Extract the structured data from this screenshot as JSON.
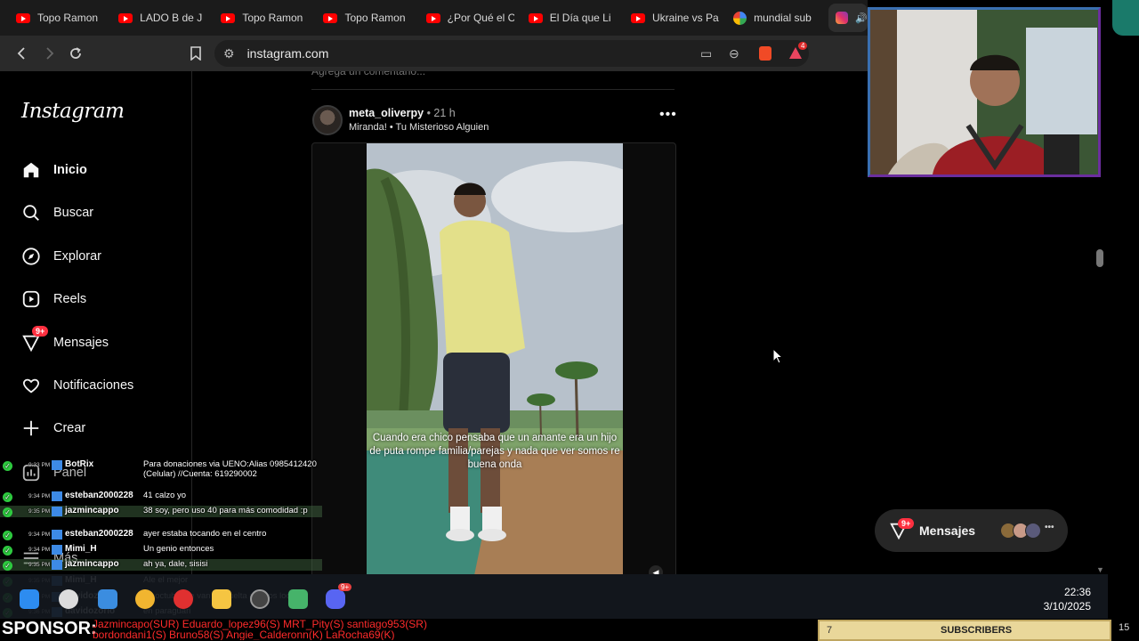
{
  "browser": {
    "tabs": [
      {
        "title": "Topo Ramon",
        "icon": "youtube-icon"
      },
      {
        "title": "LADO B de J",
        "icon": "youtube-icon"
      },
      {
        "title": "Topo Ramon",
        "icon": "youtube-icon"
      },
      {
        "title": "Topo Ramon",
        "icon": "youtube-icon"
      },
      {
        "title": "¿Por Qué el C",
        "icon": "youtube-icon"
      },
      {
        "title": "El Día que Li",
        "icon": "youtube-icon"
      },
      {
        "title": "Ukraine vs Pa",
        "icon": "youtube-icon"
      },
      {
        "title": "mundial sub",
        "icon": "google-icon"
      }
    ],
    "url": "instagram.com",
    "brave_badge": "4"
  },
  "instagram": {
    "logo": "Instagram",
    "nav": [
      {
        "label": "Inicio",
        "icon": "home-icon"
      },
      {
        "label": "Buscar",
        "icon": "search-icon"
      },
      {
        "label": "Explorar",
        "icon": "compass-icon"
      },
      {
        "label": "Reels",
        "icon": "reels-icon"
      },
      {
        "label": "Mensajes",
        "icon": "messenger-icon",
        "badge": "9+"
      },
      {
        "label": "Notificaciones",
        "icon": "heart-icon"
      },
      {
        "label": "Crear",
        "icon": "plus-icon"
      },
      {
        "label": "Panel",
        "icon": "dashboard-icon"
      },
      {
        "label": "Más",
        "icon": "menu-icon"
      }
    ],
    "comment_placeholder": "Agrega un comentario...",
    "post": {
      "username": "meta_oliverpy",
      "time": "• 21 h",
      "subtitle": "Miranda! • Tu Misterioso Alguien",
      "caption": "Cuando era chico pensaba que un amante era un hijo de puta rompe familia/parejas y nada que ver somos re buena onda"
    },
    "messages_pill": {
      "label": "Mensajes",
      "badge": "9+"
    }
  },
  "chat": [
    {
      "time": "9:33 PM",
      "user": "BotRix",
      "msg": "Para donaciones via UENO:Alias 0985412420 (Celular) //Cuenta: 619290002",
      "highlight": false
    },
    {
      "time": "9:34 PM",
      "user": "esteban2000228",
      "msg": "41 calzo yo",
      "highlight": false
    },
    {
      "time": "9:35 PM",
      "user": "jazmincappo",
      "msg": "38 soy, pero uso 40 para más comodidad :p",
      "highlight": true
    },
    {
      "time": "9:34 PM",
      "user": "esteban2000228",
      "msg": "ayer estaba tocando en el centro",
      "highlight": false
    },
    {
      "time": "9:34 PM",
      "user": "Mimi_H",
      "msg": "Un genio entonces",
      "highlight": false
    },
    {
      "time": "9:35 PM",
      "user": "jazmincappo",
      "msg": "ah ya, dale, sisisi",
      "highlight": true
    },
    {
      "time": "9:35 PM",
      "user": "Mimi_H",
      "msg": "Ale el mejor",
      "highlight": false
    },
    {
      "time": "9:35 PM",
      "user": "davidozorio",
      "msg": "en octubre se van de vuelta a autos locos",
      "highlight": false
    },
    {
      "time": "9:36 PM",
      "user": "davidozorio",
      "msg": "en paraguari",
      "highlight": false
    }
  ],
  "taskbar": {
    "time": "22:36",
    "date": "3/10/2025",
    "discord_badge": "9+"
  },
  "sponsor": {
    "label": "SPONSOR:",
    "line1": "Jazmincapo(SUR) Eduardo_lopez96(S) MRT_Pity(S) santiago953(SR)",
    "line2": "bordondani1(S) Bruno58(S) Angie_Calderonn(K) LaRocha69(K)",
    "subs_count": "7",
    "subs_label": "SUBSCRIBERS",
    "subs_total": "15"
  },
  "colors": {
    "ig_badge": "#ff3040",
    "sponsor_text": "#ff2b2b",
    "subs_bar": "#e9d79a"
  }
}
